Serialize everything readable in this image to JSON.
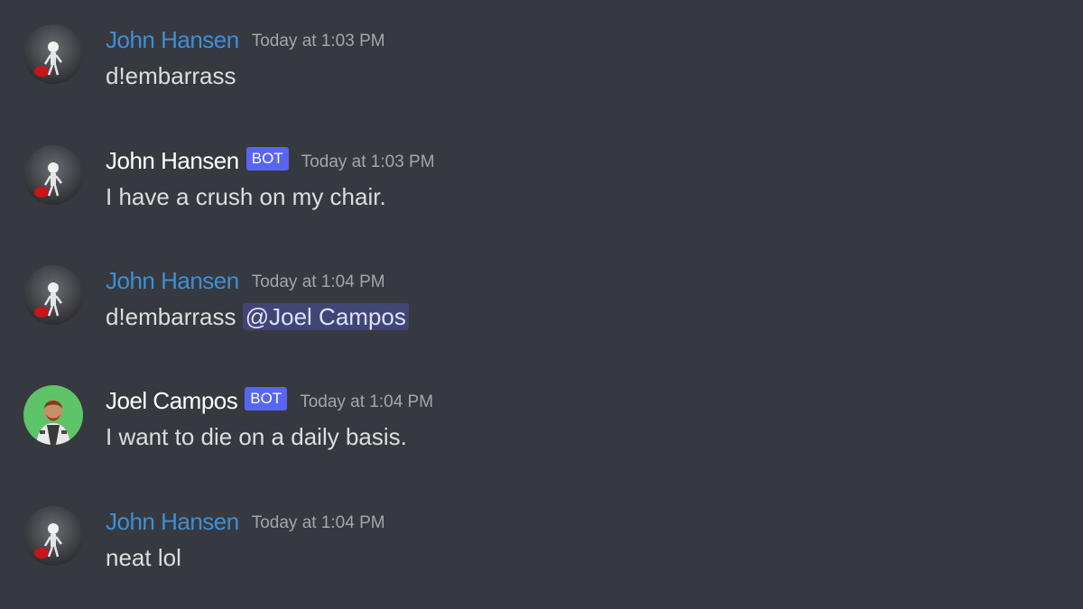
{
  "messages": [
    {
      "author": "John Hansen",
      "author_color": "#3e8fd6",
      "bot": false,
      "timestamp": "Today at 1:03 PM",
      "text": "d!embarrass",
      "avatar": "skeleton-avatar"
    },
    {
      "author": "John Hansen",
      "author_color": "#ffffff",
      "bot": true,
      "bot_label": "BOT",
      "timestamp": "Today at 1:03 PM",
      "text": "I have a crush on my chair.",
      "avatar": "skeleton-avatar"
    },
    {
      "author": "John Hansen",
      "author_color": "#3e8fd6",
      "bot": false,
      "timestamp": "Today at 1:04 PM",
      "text": "d!embarrass",
      "mention": "@Joel Campos",
      "avatar": "skeleton-avatar"
    },
    {
      "author": "Joel Campos",
      "author_color": "#ffffff",
      "bot": true,
      "bot_label": "BOT",
      "timestamp": "Today at 1:04 PM",
      "text": "I want to die on a daily basis.",
      "avatar": "person-avatar"
    },
    {
      "author": "John Hansen",
      "author_color": "#3e8fd6",
      "bot": false,
      "timestamp": "Today at 1:04 PM",
      "text": "neat lol",
      "avatar": "skeleton-avatar"
    }
  ],
  "colors": {
    "background": "#36393f",
    "bot_tag": "#5865f2",
    "mention_bg": "#414675",
    "timestamp": "#a3a6aa"
  }
}
